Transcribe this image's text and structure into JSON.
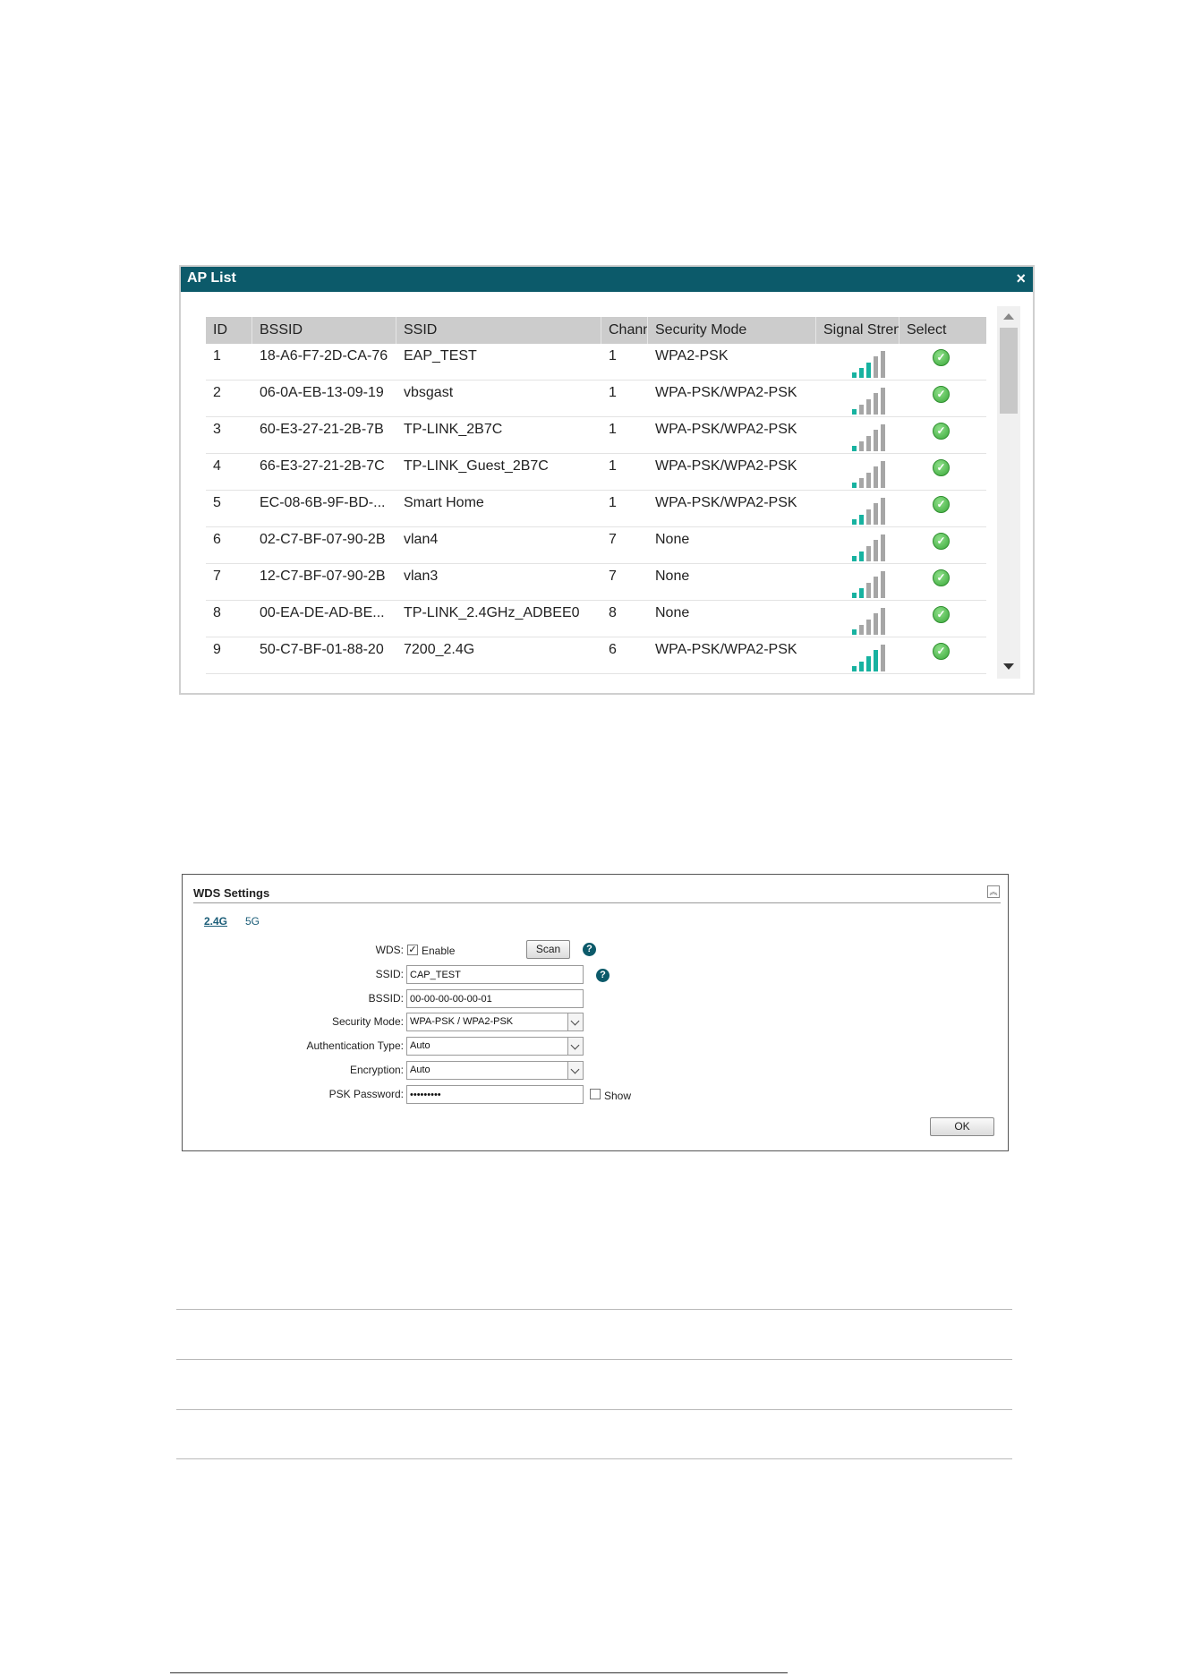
{
  "ap_list": {
    "title": "AP List",
    "close_symbol": "×",
    "columns": [
      "ID",
      "BSSID",
      "SSID",
      "Chann",
      "Security Mode",
      "Signal Stren",
      "Select"
    ],
    "rows": [
      {
        "id": "1",
        "bssid": "18-A6-F7-2D-CA-76",
        "ssid": "EAP_TEST",
        "channel": "1",
        "security": "WPA2-PSK",
        "signal_bars": 3
      },
      {
        "id": "2",
        "bssid": "06-0A-EB-13-09-19",
        "ssid": "vbsgast",
        "channel": "1",
        "security": "WPA-PSK/WPA2-PSK",
        "signal_bars": 1
      },
      {
        "id": "3",
        "bssid": "60-E3-27-21-2B-7B",
        "ssid": "TP-LINK_2B7C",
        "channel": "1",
        "security": "WPA-PSK/WPA2-PSK",
        "signal_bars": 1
      },
      {
        "id": "4",
        "bssid": "66-E3-27-21-2B-7C",
        "ssid": "TP-LINK_Guest_2B7C",
        "channel": "1",
        "security": "WPA-PSK/WPA2-PSK",
        "signal_bars": 1
      },
      {
        "id": "5",
        "bssid": "EC-08-6B-9F-BD-...",
        "ssid": "Smart Home",
        "channel": "1",
        "security": "WPA-PSK/WPA2-PSK",
        "signal_bars": 2
      },
      {
        "id": "6",
        "bssid": "02-C7-BF-07-90-2B",
        "ssid": "vlan4",
        "channel": "7",
        "security": "None",
        "signal_bars": 2
      },
      {
        "id": "7",
        "bssid": "12-C7-BF-07-90-2B",
        "ssid": "vlan3",
        "channel": "7",
        "security": "None",
        "signal_bars": 2
      },
      {
        "id": "8",
        "bssid": "00-EA-DE-AD-BE...",
        "ssid": "TP-LINK_2.4GHz_ADBEE0",
        "channel": "8",
        "security": "None",
        "signal_bars": 1
      },
      {
        "id": "9",
        "bssid": "50-C7-BF-01-88-20",
        "ssid": "7200_2.4G",
        "channel": "6",
        "security": "WPA-PSK/WPA2-PSK",
        "signal_bars": 4
      }
    ],
    "colors": {
      "titlebar": "#0c5a6a",
      "signal_on": "#17b2a0",
      "signal_off": "#a6a6a6"
    },
    "select_icon": "check-circle-icon"
  },
  "wds": {
    "title": "WDS Settings",
    "tabs": [
      "2.4G",
      "5G"
    ],
    "wds_label": "WDS:",
    "enable_label": "Enable",
    "enable_checked": true,
    "scan_label": "Scan",
    "help_symbol": "?",
    "ssid_label": "SSID:",
    "ssid_value": "CAP_TEST",
    "bssid_label": "BSSID:",
    "bssid_value": "00-00-00-00-00-01",
    "security_mode_label": "Security Mode:",
    "security_mode_value": "WPA-PSK / WPA2-PSK",
    "auth_type_label": "Authentication Type:",
    "auth_type_value": "Auto",
    "encryption_label": "Encryption:",
    "encryption_value": "Auto",
    "psk_label": "PSK Password:",
    "psk_value": "•••••••••",
    "show_label": "Show",
    "ok_label": "OK"
  }
}
